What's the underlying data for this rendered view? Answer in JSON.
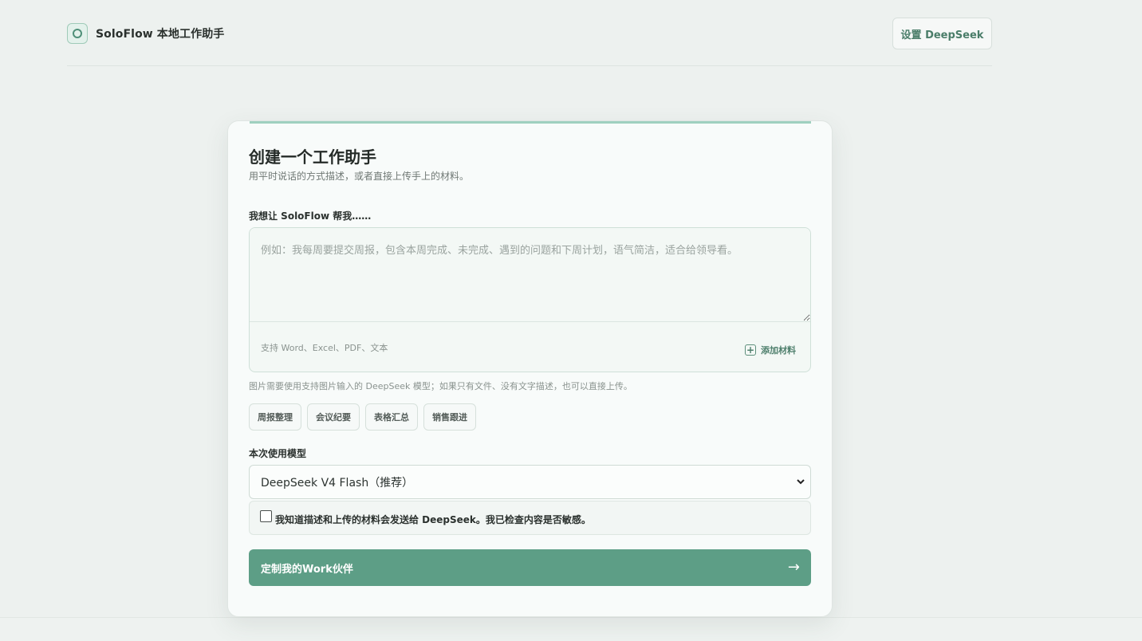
{
  "header": {
    "brand_title": "SoloFlow 本地工作助手",
    "settings_label": "设置 DeepSeek",
    "brand_icon": "circle-logo-icon"
  },
  "card": {
    "title": "创建一个工作助手",
    "subtitle": "用平时说话的方式描述，或者直接上传手上的材料。",
    "prompt_label": "我想让 SoloFlow 帮我……",
    "prompt_placeholder": "例如：我每周要提交周报，包含本周完成、未完成、遇到的问题和下周计划，语气简洁，适合给领导看。",
    "prompt_value": "",
    "support_text": "支持 Word、Excel、PDF、文本",
    "add_material_label": "添加材料",
    "hint_text": "图片需要使用支持图片输入的 DeepSeek 模型；如果只有文件、没有文字描述，也可以直接上传。",
    "chips": [
      {
        "label": "周报整理"
      },
      {
        "label": "会议纪要"
      },
      {
        "label": "表格汇总"
      },
      {
        "label": "销售跟进"
      }
    ],
    "model_label": "本次使用模型",
    "model_selected": "DeepSeek V4 Flash（推荐）",
    "consent_text": "我知道描述和上传的材料会发送给 DeepSeek。我已检查内容是否敏感。",
    "consent_checked": false,
    "submit_label": "定制我的Work伙伴",
    "submit_arrow": "→"
  },
  "colors": {
    "accent": "#5d9e86",
    "accent_light": "#9fd0bf",
    "background": "#edf1ef",
    "card_background": "#f8fbfa"
  }
}
